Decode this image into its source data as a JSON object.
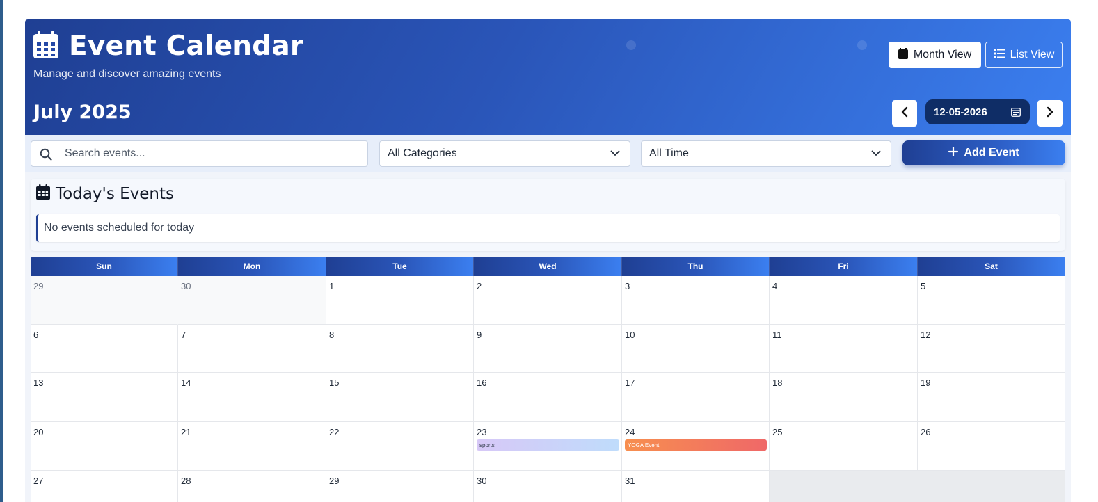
{
  "header": {
    "title": "Event Calendar",
    "subtitle": "Manage and discover amazing events",
    "current_month": "July 2025",
    "views": {
      "month_label": "Month View",
      "list_label": "List View",
      "active": "month"
    },
    "date_input_value": "12-05-2026"
  },
  "toolbar": {
    "search_placeholder": "Search events...",
    "category_selected": "All Categories",
    "time_selected": "All Time",
    "add_label": "Add Event"
  },
  "today": {
    "title": "Today's Events",
    "empty_message": "No events scheduled for today"
  },
  "calendar": {
    "weekdays": [
      "Sun",
      "Mon",
      "Tue",
      "Wed",
      "Thu",
      "Fri",
      "Sat"
    ],
    "weeks": [
      [
        {
          "d": "29",
          "other": true
        },
        {
          "d": "30",
          "other": true
        },
        {
          "d": "1"
        },
        {
          "d": "2"
        },
        {
          "d": "3"
        },
        {
          "d": "4"
        },
        {
          "d": "5"
        }
      ],
      [
        {
          "d": "6"
        },
        {
          "d": "7"
        },
        {
          "d": "8"
        },
        {
          "d": "9"
        },
        {
          "d": "10"
        },
        {
          "d": "11"
        },
        {
          "d": "12"
        }
      ],
      [
        {
          "d": "13"
        },
        {
          "d": "14"
        },
        {
          "d": "15"
        },
        {
          "d": "16"
        },
        {
          "d": "17"
        },
        {
          "d": "18"
        },
        {
          "d": "19"
        }
      ],
      [
        {
          "d": "20"
        },
        {
          "d": "21"
        },
        {
          "d": "22"
        },
        {
          "d": "23",
          "event": {
            "label": "sports",
            "type": "sports"
          }
        },
        {
          "d": "24",
          "event": {
            "label": "YOGA Event",
            "type": "yoga"
          }
        },
        {
          "d": "25"
        },
        {
          "d": "26"
        }
      ],
      [
        {
          "d": "27"
        },
        {
          "d": "28"
        },
        {
          "d": "29"
        },
        {
          "d": "30"
        },
        {
          "d": "31"
        },
        {
          "d": "",
          "blank": true
        },
        {
          "d": "",
          "blank": true
        }
      ]
    ]
  },
  "colors": {
    "brand_dark": "#1f3f93",
    "brand_light": "#3b7ff0",
    "date_pill": "#0f2d66"
  },
  "icons": [
    "calendar-icon",
    "list-icon",
    "chevron-left-icon",
    "chevron-right-icon",
    "search-icon",
    "chevron-down-icon",
    "plus-icon"
  ]
}
